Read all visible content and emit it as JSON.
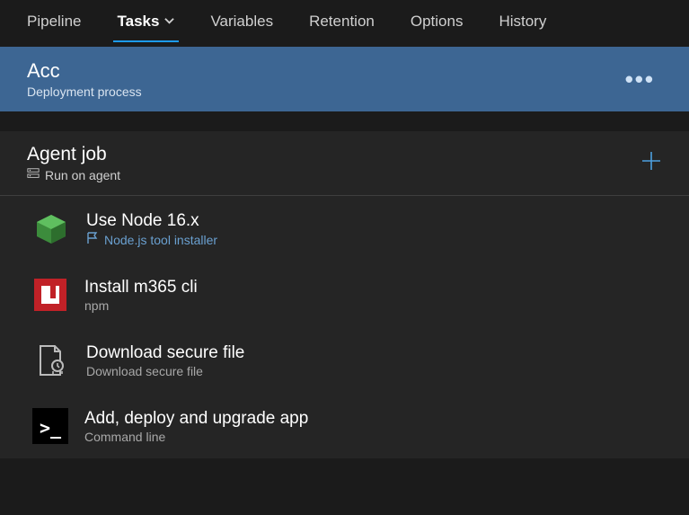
{
  "tabs": [
    "Pipeline",
    "Tasks",
    "Variables",
    "Retention",
    "Options",
    "History"
  ],
  "active_tab": "Tasks",
  "stage": {
    "title": "Acc",
    "subtitle": "Deployment process"
  },
  "job": {
    "title": "Agent job",
    "subtitle": "Run on agent"
  },
  "tasks": [
    {
      "title": "Use Node 16.x",
      "subtitle": "Node.js tool installer",
      "icon": "node",
      "subtitle_blue": true,
      "flag": true
    },
    {
      "title": "Install m365 cli",
      "subtitle": "npm",
      "icon": "npm",
      "subtitle_blue": false,
      "flag": false
    },
    {
      "title": "Download secure file",
      "subtitle": "Download secure file",
      "icon": "securefile",
      "subtitle_blue": false,
      "flag": false
    },
    {
      "title": "Add, deploy and upgrade app",
      "subtitle": "Command line",
      "icon": "terminal",
      "subtitle_blue": false,
      "flag": false
    }
  ]
}
